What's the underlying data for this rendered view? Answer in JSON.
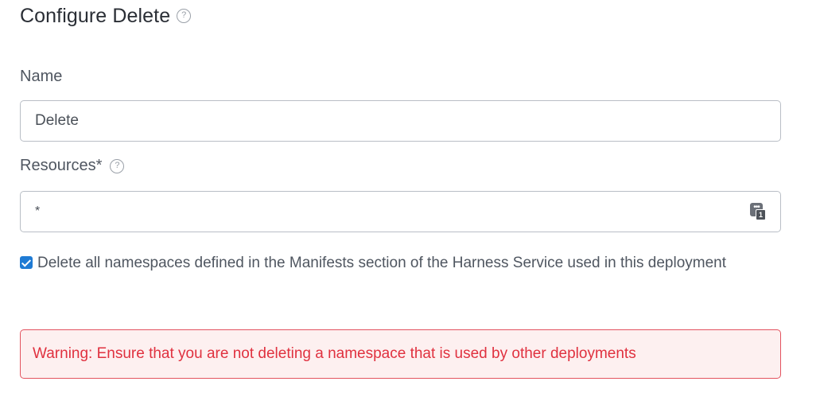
{
  "header": {
    "title": "Configure Delete",
    "help_glyph": "?"
  },
  "name_field": {
    "label": "Name",
    "value": "Delete"
  },
  "resources_field": {
    "label": "Resources*",
    "help_glyph": "?",
    "value": "*",
    "expression_icon": "expression-input-icon",
    "expression_dots": "•••",
    "expression_badge": "1"
  },
  "namespace_checkbox": {
    "checked": true,
    "label": "Delete all namespaces defined in the Manifests section of the Harness Service used in this deployment"
  },
  "warning": {
    "text": "Warning: Ensure that you are not deleting a namespace that is used by other deployments"
  },
  "colors": {
    "accent": "#1f7bd4",
    "warning_text": "#e0313f",
    "warning_bg": "#fdf0f0",
    "warning_border": "#e3535f"
  }
}
